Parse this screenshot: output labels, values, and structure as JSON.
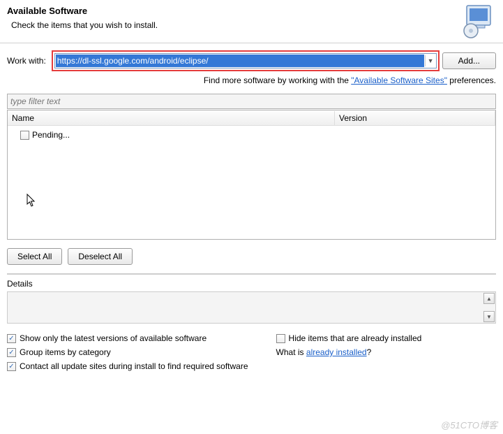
{
  "header": {
    "title": "Available Software",
    "subtitle": "Check the items that you wish to install."
  },
  "workWith": {
    "label": "Work with:",
    "value": "https://dl-ssl.google.com/android/eclipse/",
    "addButton": "Add..."
  },
  "findMore": {
    "prefix": "Find more software by working with the ",
    "link": "\"Available Software Sites\"",
    "suffix": " preferences."
  },
  "filter": {
    "placeholder": "type filter text"
  },
  "tree": {
    "columns": {
      "name": "Name",
      "version": "Version"
    },
    "items": [
      {
        "label": "Pending..."
      }
    ]
  },
  "buttons": {
    "selectAll": "Select All",
    "deselectAll": "Deselect All"
  },
  "details": {
    "label": "Details"
  },
  "options": {
    "showLatest": "Show only the latest versions of available software",
    "hideInstalled": "Hide items that are already installed",
    "groupCategory": "Group items by category",
    "whatIsPrefix": "What is ",
    "whatIsLink": "already installed",
    "whatIsSuffix": "?",
    "contactSites": "Contact all update sites during install to find required software"
  },
  "watermark": "@51CTO博客"
}
